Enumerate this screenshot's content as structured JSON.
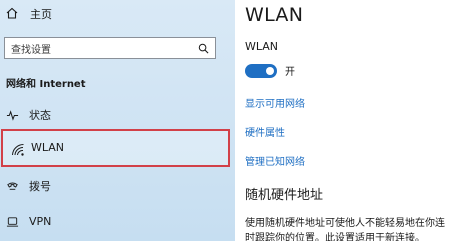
{
  "sidebar": {
    "home_label": "主页",
    "search_placeholder": "查找设置",
    "section_title": "网络和 Internet",
    "items": [
      {
        "label": "状态",
        "icon": "status-icon"
      },
      {
        "label": "WLAN",
        "icon": "wifi-icon",
        "selected": true
      },
      {
        "label": "拨号",
        "icon": "dial-up-icon"
      },
      {
        "label": "VPN",
        "icon": "vpn-icon"
      }
    ]
  },
  "main": {
    "title": "WLAN",
    "wlan_label": "WLAN",
    "toggle_state": "开",
    "toggle_on": true,
    "links": [
      "显示可用网络",
      "硬件属性",
      "管理已知网络"
    ],
    "random_hw_title": "随机硬件地址",
    "random_hw_desc_lines": [
      "使用随机硬件地址可使他人不能轻易地在你连",
      "时跟踪你的位置。此设置适用于新连接。"
    ]
  },
  "colors": {
    "accent": "#1f6fc3",
    "selection_border": "#d24048",
    "sidebar_bg": "#d3e6f5"
  }
}
